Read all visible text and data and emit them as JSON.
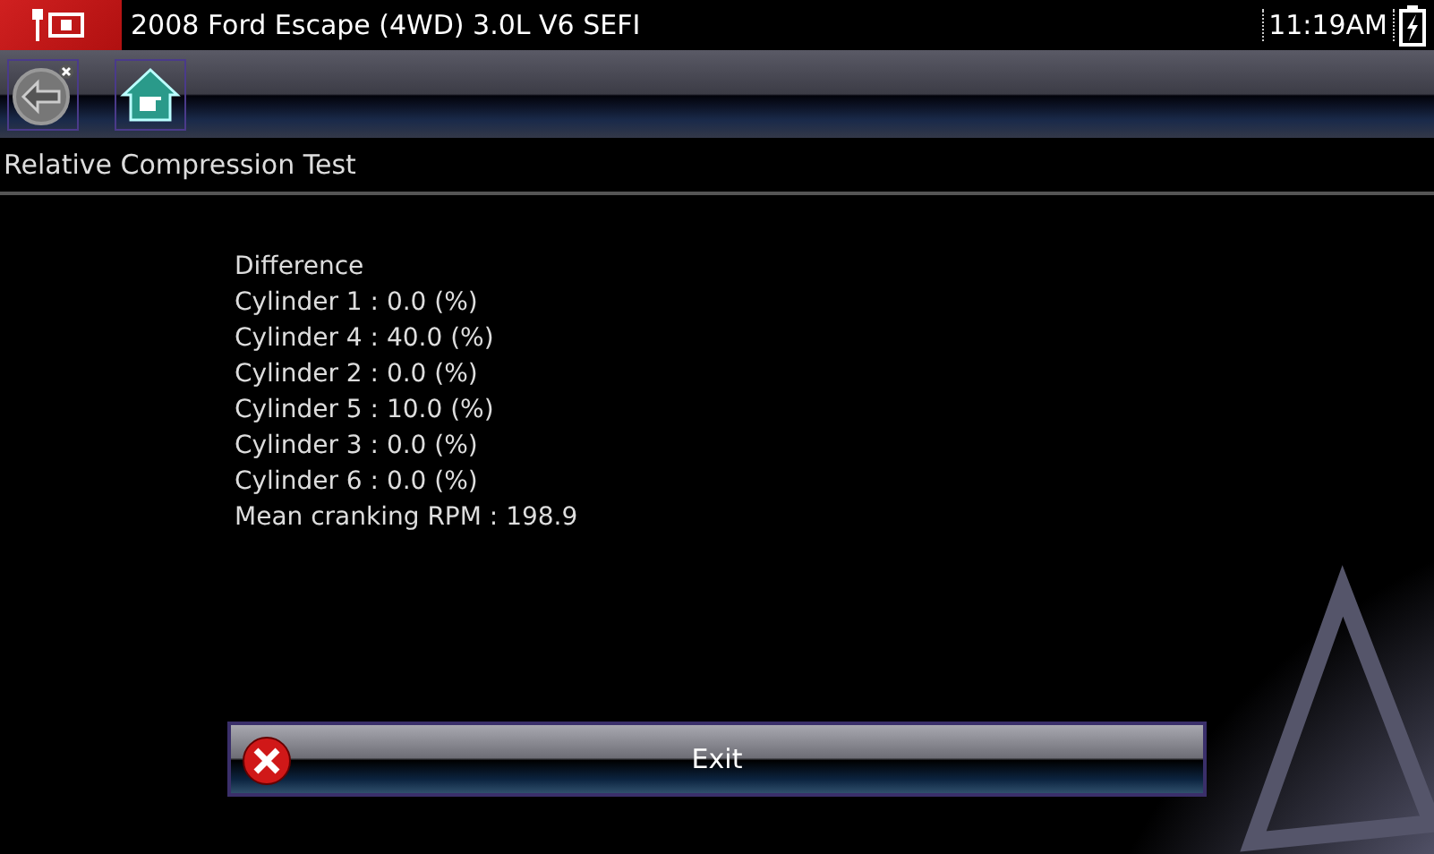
{
  "header": {
    "vehicle": "2008 Ford Escape (4WD) 3.0L V6 SEFI",
    "time": "11:19AM"
  },
  "screen_title": "Relative Compression Test",
  "results": [
    "Difference",
    "Cylinder 1 : 0.0 (%)",
    "Cylinder 4 : 40.0 (%)",
    "Cylinder 2 : 0.0 (%)",
    "Cylinder 5 : 10.0 (%)",
    "Cylinder 3 : 0.0 (%)",
    "Cylinder 6 : 0.0 (%)",
    "Mean cranking RPM : 198.9"
  ],
  "buttons": [
    {
      "label": "Exit"
    }
  ]
}
